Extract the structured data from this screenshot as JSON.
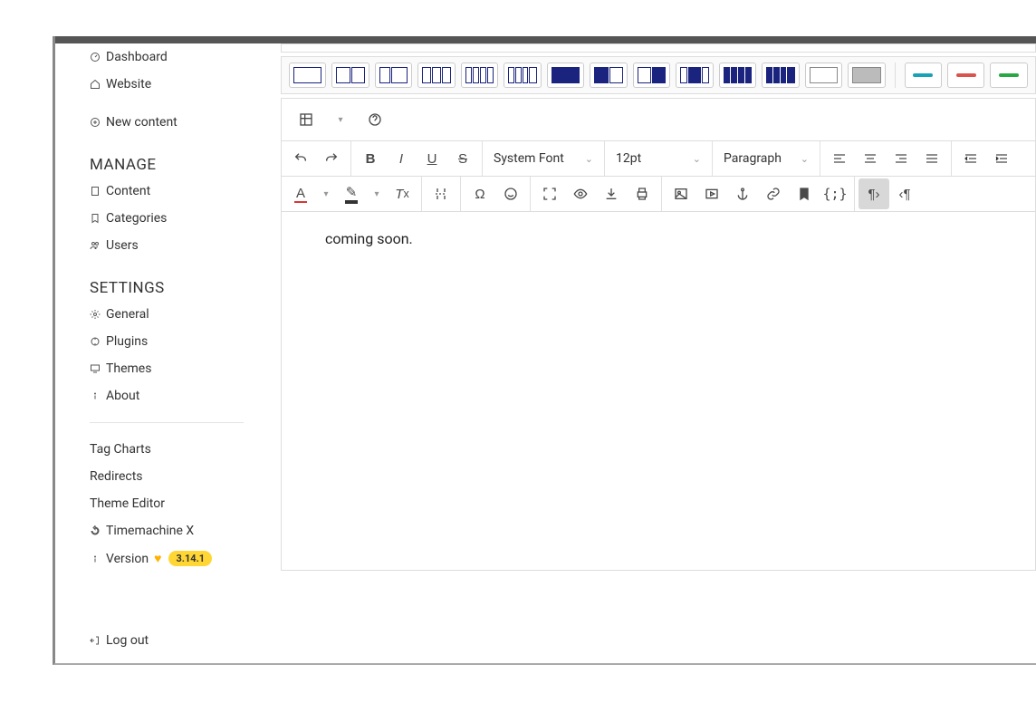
{
  "sidebar": {
    "top": {
      "dashboard": "Dashboard",
      "website": "Website",
      "new_content": "New content"
    },
    "manage": {
      "title": "MANAGE",
      "content": "Content",
      "categories": "Categories",
      "users": "Users"
    },
    "settings": {
      "title": "SETTINGS",
      "general": "General",
      "plugins": "Plugins",
      "themes": "Themes",
      "about": "About"
    },
    "extras": {
      "tag_charts": "Tag Charts",
      "redirects": "Redirects",
      "theme_editor": "Theme Editor",
      "timemachine": "Timemachine X",
      "version_label": "Version",
      "version_value": "3.14.1"
    },
    "logout": "Log out"
  },
  "editor": {
    "font_family": "System Font",
    "font_size": "12pt",
    "block_format": "Paragraph",
    "content_text": "coming soon."
  }
}
